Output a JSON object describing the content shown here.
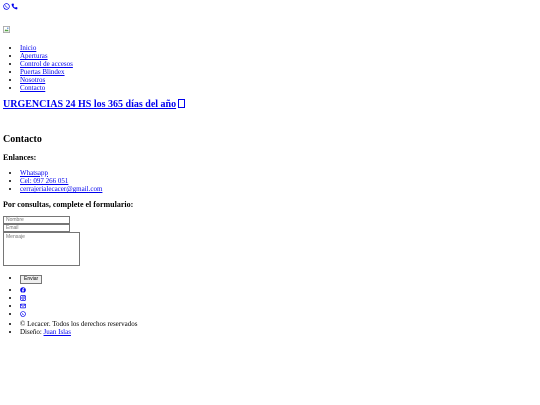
{
  "header": {
    "top_icons": [
      "whatsapp-icon",
      "phone-icon"
    ],
    "logo": "broken-image-icon"
  },
  "nav": {
    "items": [
      {
        "label": "Inicio"
      },
      {
        "label": "Aperturas"
      },
      {
        "label": "Control de accesos"
      },
      {
        "label": "Puertas Blindex"
      },
      {
        "label": "Nosotros"
      },
      {
        "label": "Contacto"
      }
    ]
  },
  "urgent": {
    "label": "URGENCIAS 24 HS los 365 días del año"
  },
  "contact": {
    "title": "Contacto",
    "links_title": "Enlances:",
    "links": [
      {
        "label": "Whatsapp"
      },
      {
        "label": "Cel: 097 266 051"
      },
      {
        "label": "cerrajerialecacer@gmail.com"
      }
    ],
    "form_title": "Por consultas, complete el formulario:",
    "form": {
      "name_placeholder": "Nombre",
      "email_placeholder": "Email",
      "message_placeholder": "Mensaje",
      "submit_label": "Enviar"
    }
  },
  "social": {
    "icons": [
      "facebook-icon",
      "instagram-icon",
      "email-icon",
      "whatsapp-icon"
    ],
    "link_color": "#0000ee"
  },
  "footer": {
    "copyright": "© Lecacer. Todos los derechos reservados",
    "design_prefix": "Diseño: ",
    "design_author": "Juan Islas"
  }
}
